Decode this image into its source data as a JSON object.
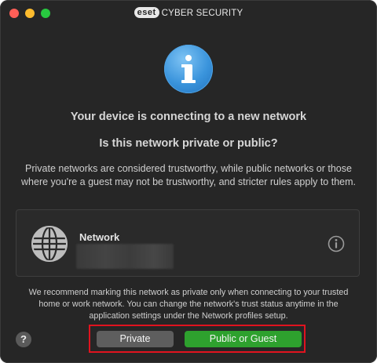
{
  "window": {
    "brand_logo": "eset",
    "brand_text": "CYBER SECURITY"
  },
  "dialog": {
    "icon": "info-icon",
    "heading": "Your device is connecting to a new network",
    "question": "Is this network private or public?",
    "description": "Private networks are considered trustworthy, while public networks or those where you're a guest may not be trustworthy, and stricter rules apply to them."
  },
  "network": {
    "icon": "globe-icon",
    "label": "Network",
    "info_icon": "info-circle-icon"
  },
  "note": "We recommend marking this network as private only when connecting to your trusted home or work network. You can change the network's trust status anytime in the application settings under the Network profiles setup.",
  "buttons": {
    "help": "?",
    "private": "Private",
    "public": "Public or Guest"
  },
  "colors": {
    "background": "#262626",
    "accent_green": "#2ea12e",
    "private_gray": "#5e5e5e",
    "highlight_red": "#e0131f",
    "info_blue": "#3a94dc"
  }
}
